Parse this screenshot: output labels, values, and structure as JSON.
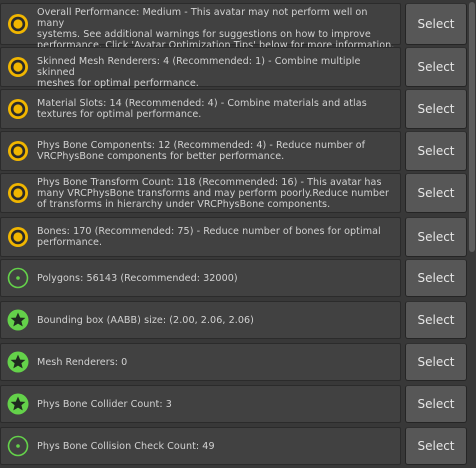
{
  "colors": {
    "warning": "#f1b600",
    "ok": "#64d24a",
    "row_bg": "#414141",
    "button_bg": "#575757",
    "text": "#d2d2d2"
  },
  "items": [
    {
      "icon": "warning-icon",
      "text": "Overall Performance: Medium - This avatar may not perform well on many systems. See additional warnings for suggestions on how to improve performance. Click 'Avatar Optimization Tips' below for more information.",
      "button": "Select"
    },
    {
      "icon": "warning-icon",
      "text": "Skinned Mesh Renderers: 4 (Recommended: 1) - Combine multiple skinned meshes for optimal performance.",
      "button": "Select"
    },
    {
      "icon": "warning-icon",
      "text": "Material Slots: 14 (Recommended: 4) - Combine materials and atlas textures for optimal performance.",
      "button": "Select"
    },
    {
      "icon": "warning-icon",
      "text": "Phys Bone Components: 12 (Recommended: 4) - Reduce number of VRCPhysBone components for better performance.",
      "button": "Select"
    },
    {
      "icon": "warning-icon",
      "text": "Phys Bone Transform Count: 118 (Recommended: 16) - This avatar has many VRCPhysBone transforms and may perform poorly.Reduce number of transforms in hierarchy under VRCPhysBone components.",
      "button": "Select"
    },
    {
      "icon": "warning-icon",
      "text": "Bones: 170 (Recommended: 75) - Reduce number of bones for optimal performance.",
      "button": "Select"
    },
    {
      "icon": "good-icon",
      "text": "Polygons: 56143 (Recommended: 32000)",
      "button": "Select"
    },
    {
      "icon": "excellent-icon",
      "text": "Bounding box (AABB) size: (2.00, 2.06, 2.06)",
      "button": "Select"
    },
    {
      "icon": "excellent-icon",
      "text": "Mesh Renderers: 0",
      "button": "Select"
    },
    {
      "icon": "excellent-icon",
      "text": "Phys Bone Collider Count: 3",
      "button": "Select"
    },
    {
      "icon": "good-icon",
      "text": "Phys Bone Collision Check Count: 49",
      "button": "Select"
    }
  ]
}
